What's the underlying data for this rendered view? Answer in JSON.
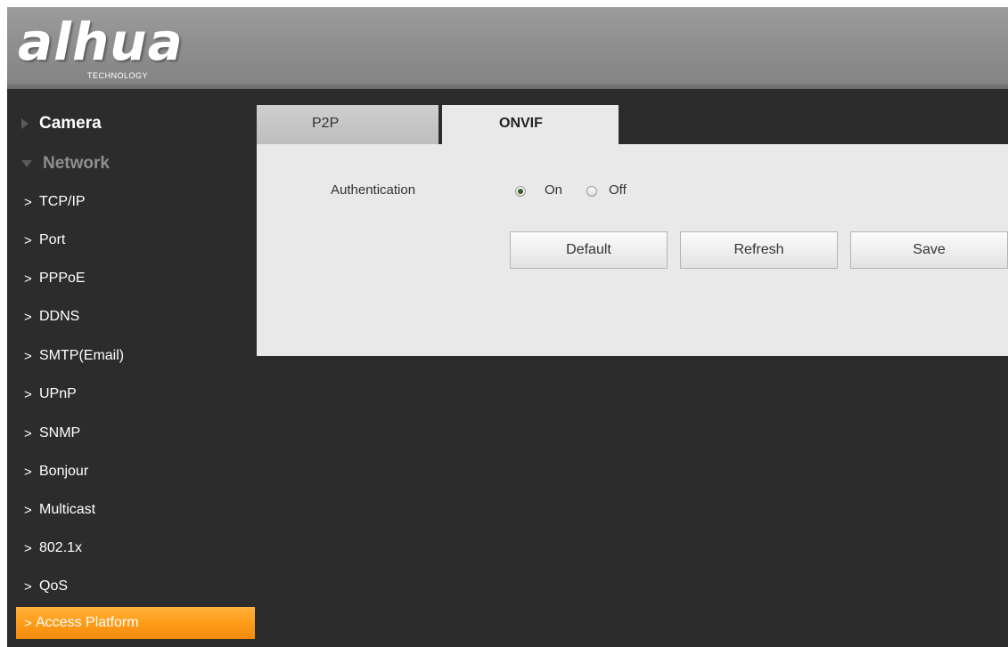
{
  "brand": {
    "logo_text": "alhua",
    "logo_subtext": "TECHNOLOGY"
  },
  "sidebar": {
    "sections": [
      {
        "label": "Camera",
        "state": "collapsed"
      },
      {
        "label": "Network",
        "state": "expanded"
      }
    ],
    "items": [
      {
        "label": "TCP/IP"
      },
      {
        "label": "Port"
      },
      {
        "label": "PPPoE"
      },
      {
        "label": "DDNS"
      },
      {
        "label": "SMTP(Email)"
      },
      {
        "label": "UPnP"
      },
      {
        "label": "SNMP"
      },
      {
        "label": "Bonjour"
      },
      {
        "label": "Multicast"
      },
      {
        "label": "802.1x"
      },
      {
        "label": "QoS"
      },
      {
        "label": "Access Platform",
        "active": true
      }
    ],
    "item_icon": "chevron-right-icon",
    "active_color": "#ff9c1a"
  },
  "main": {
    "tabs": [
      {
        "label": "P2P"
      },
      {
        "label": "ONVIF",
        "active": true
      }
    ],
    "authentication": {
      "label": "Authentication",
      "options": [
        {
          "label": "On",
          "checked": true
        },
        {
          "label": "Off",
          "checked": false
        }
      ]
    },
    "buttons": {
      "default_label": "Default",
      "refresh_label": "Refresh",
      "save_label": "Save"
    }
  }
}
